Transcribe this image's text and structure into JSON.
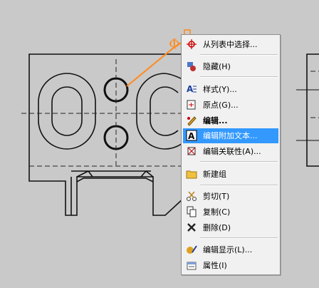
{
  "canvas": {
    "background": "#c9c9c9",
    "line_color": "#111111",
    "accent_color": "#ff8a1e",
    "leader_text": "Φ"
  },
  "context_menu": {
    "highlight_color": "#3399ff",
    "items": [
      {
        "label": "从列表中选择...",
        "icon": "crosshair-select-icon"
      },
      {
        "label": "隐藏(H)",
        "icon": "hide-icon"
      },
      {
        "label": "样式(Y)...",
        "icon": "style-icon"
      },
      {
        "label": "原点(G)...",
        "icon": "origin-icon"
      },
      {
        "label": "编辑...",
        "icon": "edit-icon"
      },
      {
        "label": "编辑附加文本...",
        "icon": "appended-text-icon"
      },
      {
        "label": "编辑关联性(A)...",
        "icon": "associativity-icon"
      },
      {
        "label": "新建组",
        "icon": "folder-icon"
      },
      {
        "label": "剪切(T)",
        "icon": "cut-icon"
      },
      {
        "label": "复制(C)",
        "icon": "copy-icon"
      },
      {
        "label": "删除(D)",
        "icon": "delete-icon"
      },
      {
        "label": "编辑显示(L)...",
        "icon": "edit-display-icon"
      },
      {
        "label": "属性(I)",
        "icon": "properties-icon"
      }
    ]
  }
}
